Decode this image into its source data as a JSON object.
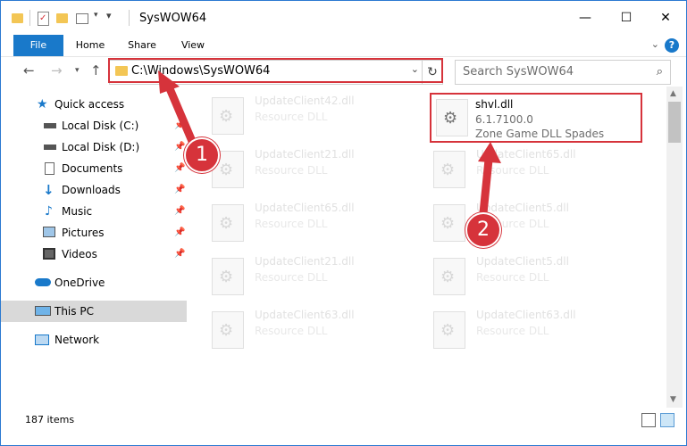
{
  "window": {
    "title": "SysWOW64"
  },
  "ribbon": {
    "tabs": [
      "File",
      "Home",
      "Share",
      "View"
    ]
  },
  "address": {
    "path": "C:\\Windows\\SysWOW64"
  },
  "search": {
    "placeholder": "Search SysWOW64"
  },
  "sidebar": {
    "items": [
      {
        "label": "Quick access",
        "icon": "star-icon",
        "pinned": false
      },
      {
        "label": "Local Disk (C:)",
        "icon": "drive-icon",
        "pinned": true
      },
      {
        "label": "Local Disk (D:)",
        "icon": "drive-icon",
        "pinned": true
      },
      {
        "label": "Documents",
        "icon": "documents-icon",
        "pinned": true
      },
      {
        "label": "Downloads",
        "icon": "download-icon",
        "pinned": true
      },
      {
        "label": "Music",
        "icon": "music-icon",
        "pinned": true
      },
      {
        "label": "Pictures",
        "icon": "pictures-icon",
        "pinned": true
      },
      {
        "label": "Videos",
        "icon": "videos-icon",
        "pinned": true
      },
      {
        "label": "OneDrive",
        "icon": "cloud-icon",
        "pinned": false
      },
      {
        "label": "This PC",
        "icon": "computer-icon",
        "pinned": false,
        "selected": true
      },
      {
        "label": "Network",
        "icon": "network-icon",
        "pinned": false
      }
    ]
  },
  "files": {
    "left": [
      {
        "name": "UpdateClient42.dll",
        "type": "Resource DLL"
      },
      {
        "name": "UpdateClient21.dll",
        "type": "Resource DLL"
      },
      {
        "name": "UpdateClient65.dll",
        "type": "Resource DLL"
      },
      {
        "name": "UpdateClient21.dll",
        "type": "Resource DLL"
      },
      {
        "name": "UpdateClient63.dll",
        "type": "Resource DLL"
      }
    ],
    "right": [
      {
        "name": "UpdateClient65.dll",
        "type": "Resource DLL"
      },
      {
        "name": "UpdateClient5.dll",
        "type": "Resource DLL"
      },
      {
        "name": "UpdateClient5.dll",
        "type": "Resource DLL"
      },
      {
        "name": "UpdateClient63.dll",
        "type": "Resource DLL"
      }
    ],
    "highlighted": {
      "name": "shvl.dll",
      "version": "6.1.7100.0",
      "description": "Zone Game DLL  Spades"
    }
  },
  "status": {
    "count": "187 items"
  },
  "annotations": {
    "step1": "1",
    "step2": "2",
    "color": "#d6333b"
  }
}
